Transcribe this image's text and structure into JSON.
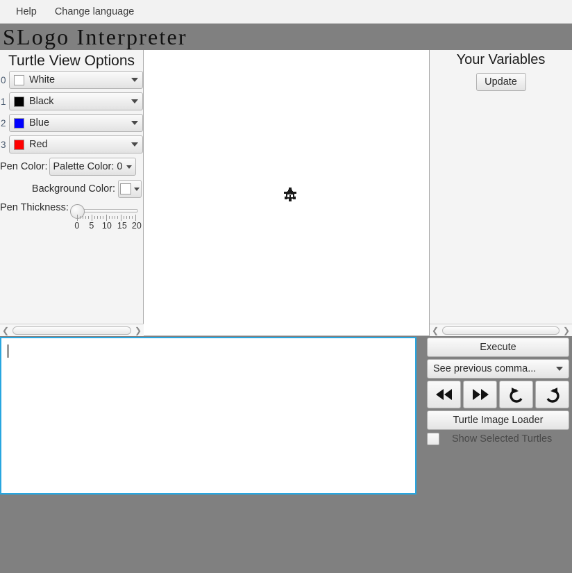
{
  "menu": {
    "items": [
      {
        "label": "Help"
      },
      {
        "label": "Change language"
      }
    ]
  },
  "app": {
    "title": "SLogo Interpreter"
  },
  "turtle_view_options": {
    "title": "Turtle View Options",
    "palette": [
      {
        "index": "0",
        "label": "White",
        "color": "#ffffff"
      },
      {
        "index": "1",
        "label": "Black",
        "color": "#000000"
      },
      {
        "index": "2",
        "label": "Blue",
        "color": "#0000ff"
      },
      {
        "index": "3",
        "label": "Red",
        "color": "#ff0000"
      }
    ],
    "pen_color": {
      "label": "Pen Color:",
      "value": "Palette Color: 0"
    },
    "background_color": {
      "label": "Background Color:",
      "value": "#ffffff"
    },
    "pen_thickness": {
      "label": "Pen Thickness:",
      "value": 0,
      "min": 0,
      "max": 20,
      "tick_labels": [
        "0",
        "5",
        "10",
        "15",
        "20"
      ]
    }
  },
  "canvas": {
    "background": "#ffffff",
    "turtle_icon": "turtle-sprite"
  },
  "variables_panel": {
    "title": "Your Variables",
    "update_label": "Update"
  },
  "scrollbars": {
    "left_arrow_icon": "chevron-left-icon",
    "right_arrow_icon": "chevron-right-icon"
  },
  "command_input": {
    "value": "",
    "focus_color": "#28a6e0"
  },
  "controls": {
    "execute_label": "Execute",
    "history_value": "See previous comma...",
    "nav_buttons": [
      {
        "icon": "rewind-icon",
        "name": "rewind-button"
      },
      {
        "icon": "fast-forward-icon",
        "name": "fast-forward-button"
      },
      {
        "icon": "undo-icon",
        "name": "undo-button"
      },
      {
        "icon": "redo-icon",
        "name": "redo-button"
      }
    ],
    "turtle_image_loader_label": "Turtle Image Loader",
    "show_selected_turtles": {
      "label": "Show Selected Turtles",
      "checked": false
    }
  }
}
